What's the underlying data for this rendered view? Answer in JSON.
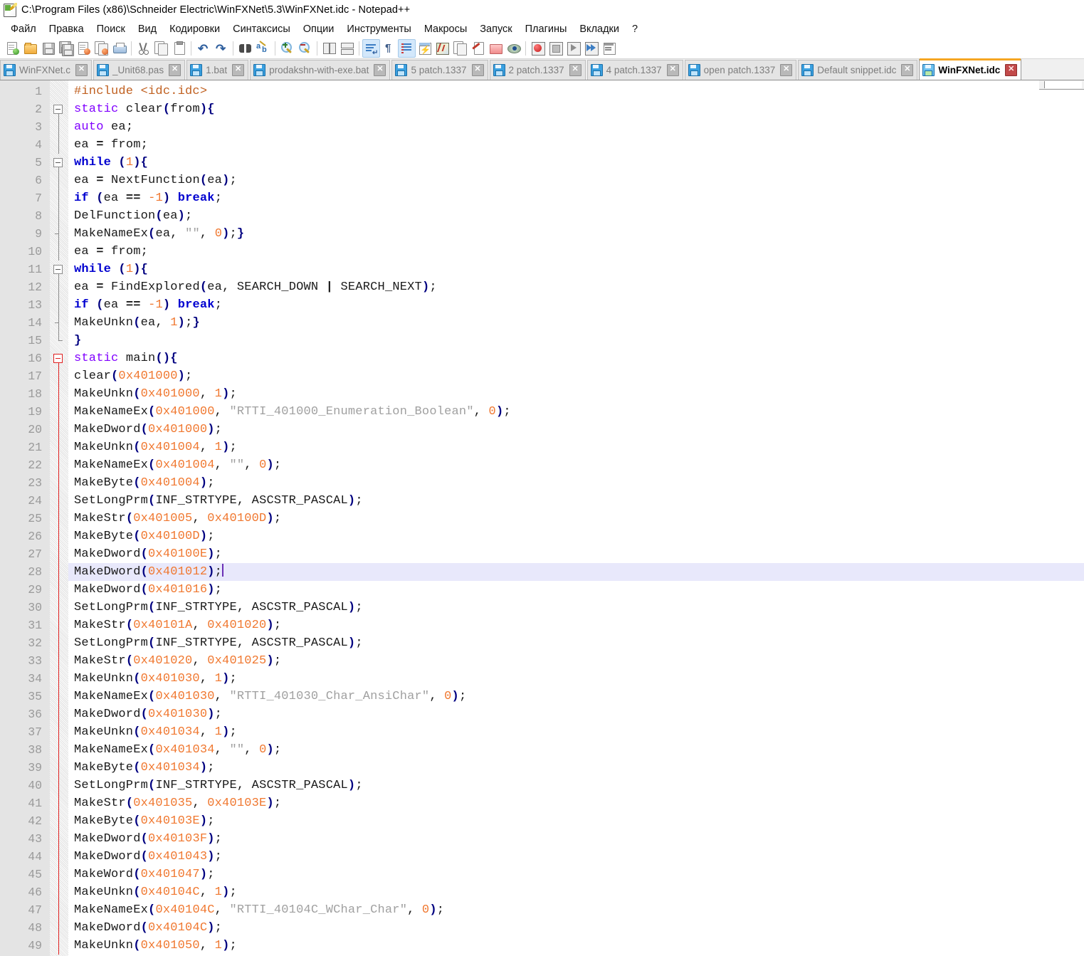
{
  "window": {
    "title": "C:\\Program Files (x86)\\Schneider Electric\\WinFXNet\\5.3\\WinFXNet.idc - Notepad++",
    "app_icon": "notepad-plus-plus-icon"
  },
  "menu": {
    "items": [
      {
        "label": "Файл"
      },
      {
        "label": "Правка"
      },
      {
        "label": "Поиск"
      },
      {
        "label": "Вид"
      },
      {
        "label": "Кодировки"
      },
      {
        "label": "Синтаксисы"
      },
      {
        "label": "Опции"
      },
      {
        "label": "Инструменты"
      },
      {
        "label": "Макросы"
      },
      {
        "label": "Запуск"
      },
      {
        "label": "Плагины"
      },
      {
        "label": "Вкладки"
      },
      {
        "label": "?"
      }
    ]
  },
  "toolbar": {
    "buttons": [
      {
        "name": "new-file-icon",
        "active": false
      },
      {
        "name": "open-file-icon",
        "active": false
      },
      {
        "name": "save-icon",
        "active": false
      },
      {
        "name": "save-all-icon",
        "active": false
      },
      {
        "name": "close-file-icon",
        "active": false
      },
      {
        "name": "close-all-files-icon",
        "active": false
      },
      {
        "name": "print-icon",
        "active": false
      },
      {
        "name": "separator",
        "active": false
      },
      {
        "name": "cut-icon",
        "active": false
      },
      {
        "name": "copy-icon",
        "active": false
      },
      {
        "name": "paste-icon",
        "active": false
      },
      {
        "name": "separator",
        "active": false
      },
      {
        "name": "undo-icon",
        "active": false
      },
      {
        "name": "redo-icon",
        "active": false
      },
      {
        "name": "separator",
        "active": false
      },
      {
        "name": "find-icon",
        "active": false
      },
      {
        "name": "replace-icon",
        "active": false
      },
      {
        "name": "separator",
        "active": false
      },
      {
        "name": "zoom-in-icon",
        "active": false
      },
      {
        "name": "zoom-out-icon",
        "active": false
      },
      {
        "name": "separator",
        "active": false
      },
      {
        "name": "sync-vertical-scroll-icon",
        "active": false
      },
      {
        "name": "sync-horizontal-scroll-icon",
        "active": false
      },
      {
        "name": "separator",
        "active": false
      },
      {
        "name": "word-wrap-icon",
        "active": true
      },
      {
        "name": "show-all-characters-icon",
        "active": false
      },
      {
        "name": "show-indent-guide-icon",
        "active": true
      },
      {
        "name": "user-defined-dialog-icon",
        "active": false
      },
      {
        "name": "document-map-icon",
        "active": false
      },
      {
        "name": "function-list-icon",
        "active": false
      },
      {
        "name": "document-switcher-icon",
        "active": false
      },
      {
        "name": "folder-as-workspace-icon",
        "active": false
      },
      {
        "name": "monitoring-icon",
        "active": false
      },
      {
        "name": "separator",
        "active": false
      },
      {
        "name": "record-macro-icon",
        "active": false
      },
      {
        "name": "stop-recording-icon",
        "active": false
      },
      {
        "name": "play-macro-icon",
        "active": false
      },
      {
        "name": "run-macro-multiple-icon",
        "active": false
      },
      {
        "name": "run-icon",
        "active": false
      }
    ]
  },
  "tabs": [
    {
      "label": "WinFXNet.c",
      "active": false
    },
    {
      "label": "_Unit68.pas",
      "active": false
    },
    {
      "label": "1.bat",
      "active": false
    },
    {
      "label": "prodakshn-with-exe.bat",
      "active": false
    },
    {
      "label": "5 patch.1337",
      "active": false
    },
    {
      "label": "2 patch.1337",
      "active": false
    },
    {
      "label": "4 patch.1337",
      "active": false
    },
    {
      "label": "open patch.1337",
      "active": false
    },
    {
      "label": "Default snippet.idc",
      "active": false
    },
    {
      "label": "WinFXNet.idc",
      "active": true
    }
  ],
  "editor": {
    "current_line": 28,
    "first_visible_line": 1,
    "last_visible_line": 49,
    "colors": {
      "keyword_declaration": "#8000ff",
      "keyword_control": "#0000d0",
      "number": "#f07830",
      "string": "#a0a0a0",
      "preprocessor": "#c06020",
      "operator_brace": "#000080",
      "current_line_bg": "#e8e8fb",
      "gutter_bg": "#e4e4e4",
      "fold_active": "#e02020",
      "active_tab_accent": "#f5a623"
    },
    "lines": [
      {
        "n": 1,
        "fold": "none",
        "text": "#include <idc.idc>"
      },
      {
        "n": 2,
        "fold": "open",
        "text": "static clear(from){"
      },
      {
        "n": 3,
        "fold": "body",
        "text": "auto ea;"
      },
      {
        "n": 4,
        "fold": "body",
        "text": "ea = from;"
      },
      {
        "n": 5,
        "fold": "open2",
        "text": "while (1){"
      },
      {
        "n": 6,
        "fold": "body2",
        "text": "ea = NextFunction(ea);"
      },
      {
        "n": 7,
        "fold": "body2",
        "text": "if (ea == -1) break;"
      },
      {
        "n": 8,
        "fold": "body2",
        "text": "DelFunction(ea);"
      },
      {
        "n": 9,
        "fold": "end2",
        "text": "MakeNameEx(ea, \"\", 0);}"
      },
      {
        "n": 10,
        "fold": "body",
        "text": "ea = from;"
      },
      {
        "n": 11,
        "fold": "open2",
        "text": "while (1){"
      },
      {
        "n": 12,
        "fold": "body2",
        "text": "ea = FindExplored(ea, SEARCH_DOWN | SEARCH_NEXT);"
      },
      {
        "n": 13,
        "fold": "body2",
        "text": "if (ea == -1) break;"
      },
      {
        "n": 14,
        "fold": "end2",
        "text": "MakeUnkn(ea, 1);}"
      },
      {
        "n": 15,
        "fold": "end",
        "text": "}"
      },
      {
        "n": 16,
        "fold": "openR",
        "text": "static main(){"
      },
      {
        "n": 17,
        "fold": "bodyR",
        "text": "clear(0x401000);"
      },
      {
        "n": 18,
        "fold": "bodyR",
        "text": "MakeUnkn(0x401000, 1);"
      },
      {
        "n": 19,
        "fold": "bodyR",
        "text": "MakeNameEx(0x401000, \"RTTI_401000_Enumeration_Boolean\", 0);"
      },
      {
        "n": 20,
        "fold": "bodyR",
        "text": "MakeDword(0x401000);"
      },
      {
        "n": 21,
        "fold": "bodyR",
        "text": "MakeUnkn(0x401004, 1);"
      },
      {
        "n": 22,
        "fold": "bodyR",
        "text": "MakeNameEx(0x401004, \"\", 0);"
      },
      {
        "n": 23,
        "fold": "bodyR",
        "text": "MakeByte(0x401004);"
      },
      {
        "n": 24,
        "fold": "bodyR",
        "text": "SetLongPrm(INF_STRTYPE, ASCSTR_PASCAL);"
      },
      {
        "n": 25,
        "fold": "bodyR",
        "text": "MakeStr(0x401005, 0x40100D);"
      },
      {
        "n": 26,
        "fold": "bodyR",
        "text": "MakeByte(0x40100D);"
      },
      {
        "n": 27,
        "fold": "bodyR",
        "text": "MakeDword(0x40100E);"
      },
      {
        "n": 28,
        "fold": "bodyR",
        "text": "MakeDword(0x401012);"
      },
      {
        "n": 29,
        "fold": "bodyR",
        "text": "MakeDword(0x401016);"
      },
      {
        "n": 30,
        "fold": "bodyR",
        "text": "SetLongPrm(INF_STRTYPE, ASCSTR_PASCAL);"
      },
      {
        "n": 31,
        "fold": "bodyR",
        "text": "MakeStr(0x40101A, 0x401020);"
      },
      {
        "n": 32,
        "fold": "bodyR",
        "text": "SetLongPrm(INF_STRTYPE, ASCSTR_PASCAL);"
      },
      {
        "n": 33,
        "fold": "bodyR",
        "text": "MakeStr(0x401020, 0x401025);"
      },
      {
        "n": 34,
        "fold": "bodyR",
        "text": "MakeUnkn(0x401030, 1);"
      },
      {
        "n": 35,
        "fold": "bodyR",
        "text": "MakeNameEx(0x401030, \"RTTI_401030_Char_AnsiChar\", 0);"
      },
      {
        "n": 36,
        "fold": "bodyR",
        "text": "MakeDword(0x401030);"
      },
      {
        "n": 37,
        "fold": "bodyR",
        "text": "MakeUnkn(0x401034, 1);"
      },
      {
        "n": 38,
        "fold": "bodyR",
        "text": "MakeNameEx(0x401034, \"\", 0);"
      },
      {
        "n": 39,
        "fold": "bodyR",
        "text": "MakeByte(0x401034);"
      },
      {
        "n": 40,
        "fold": "bodyR",
        "text": "SetLongPrm(INF_STRTYPE, ASCSTR_PASCAL);"
      },
      {
        "n": 41,
        "fold": "bodyR",
        "text": "MakeStr(0x401035, 0x40103E);"
      },
      {
        "n": 42,
        "fold": "bodyR",
        "text": "MakeByte(0x40103E);"
      },
      {
        "n": 43,
        "fold": "bodyR",
        "text": "MakeDword(0x40103F);"
      },
      {
        "n": 44,
        "fold": "bodyR",
        "text": "MakeDword(0x401043);"
      },
      {
        "n": 45,
        "fold": "bodyR",
        "text": "MakeWord(0x401047);"
      },
      {
        "n": 46,
        "fold": "bodyR",
        "text": "MakeUnkn(0x40104C, 1);"
      },
      {
        "n": 47,
        "fold": "bodyR",
        "text": "MakeNameEx(0x40104C, \"RTTI_40104C_WChar_Char\", 0);"
      },
      {
        "n": 48,
        "fold": "bodyR",
        "text": "MakeDword(0x40104C);"
      },
      {
        "n": 49,
        "fold": "bodyR",
        "text": "MakeUnkn(0x401050, 1);"
      }
    ]
  }
}
